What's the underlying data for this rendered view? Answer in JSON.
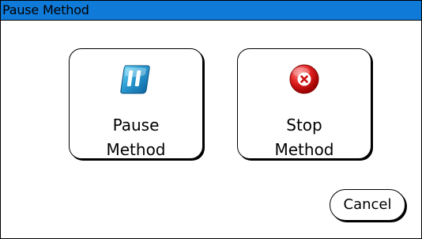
{
  "dialog": {
    "title": "Pause Method",
    "title_bar_color": "#0f7ad8"
  },
  "buttons": {
    "pause": {
      "line1": "Pause",
      "line2": "Method",
      "icon": "pause-icon"
    },
    "stop": {
      "line1": "Stop",
      "line2": "Method",
      "icon": "stop-icon"
    },
    "cancel": "Cancel"
  }
}
